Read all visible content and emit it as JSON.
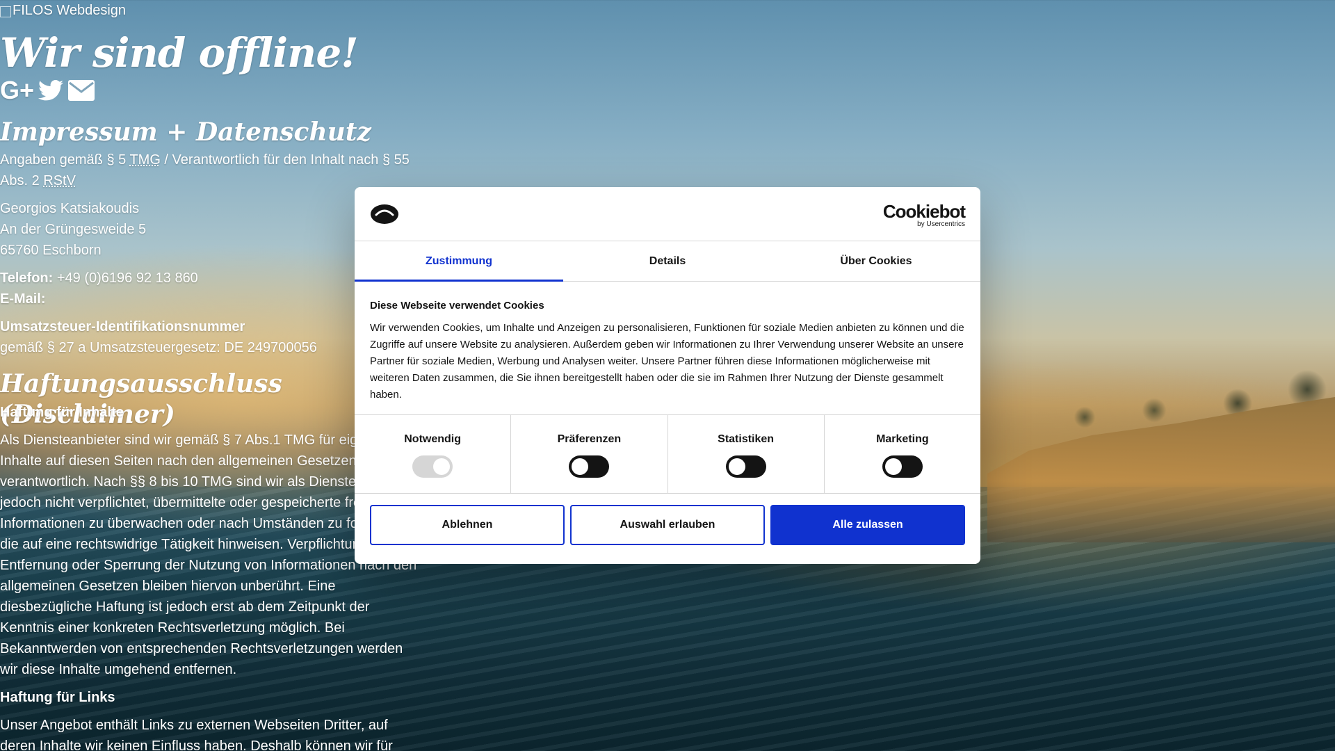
{
  "site": {
    "logo_alt": "FILOS Webdesign",
    "hero_title": "Wir sind offline!",
    "socials": [
      {
        "icon": "google-plus-icon",
        "label": "G+"
      },
      {
        "icon": "twitter-icon"
      },
      {
        "icon": "envelope-icon"
      }
    ],
    "impressum": {
      "title": "Impressum + Datenschutz",
      "intro_prefix": "Angaben gemäß § 5 ",
      "intro_abbr1": "TMG",
      "intro_mid": " / Verantwortlich für den Inhalt nach § 55 Abs. 2 ",
      "intro_abbr2": "RStV",
      "name": "Georgios Katsiakoudis",
      "street": "An der Grüngesweide 5",
      "city": "65760 Eschborn",
      "phone_label": "Telefon:",
      "phone_value": "+49 (0)6196 92 13 860",
      "email_label": "E-Mail:",
      "vat_label": "Umsatzsteuer-Identifikationsnummer",
      "vat_value": "gemäß § 27 a Umsatzsteuergesetz: DE 249700056"
    },
    "disclaimer": {
      "title": "Haftungsausschluss (Disclaimer)",
      "content_heading": "Haftung für Inhalte",
      "content_text": "Als Diensteanbieter sind wir gemäß § 7 Abs.1 TMG für eigene Inhalte auf diesen Seiten nach den allgemeinen Gesetzen verantwortlich. Nach §§ 8 bis 10 TMG sind wir als Diensteanbieter jedoch nicht verpflichtet, übermittelte oder gespeicherte fremde Informationen zu überwachen oder nach Umständen zu forschen, die auf eine rechtswidrige Tätigkeit hinweisen. Verpflichtungen zur Entfernung oder Sperrung der Nutzung von Informationen nach den allgemeinen Gesetzen bleiben hiervon unberührt. Eine diesbezügliche Haftung ist jedoch erst ab dem Zeitpunkt der Kenntnis einer konkreten Rechtsverletzung möglich. Bei Bekanntwerden von entsprechenden Rechtsverletzungen werden wir diese Inhalte umgehend entfernen.",
      "links_heading": "Haftung für Links",
      "links_text": "Unser Angebot enthält Links zu externen Webseiten Dritter, auf deren Inhalte wir keinen Einfluss haben. Deshalb können wir für"
    }
  },
  "cookie_dialog": {
    "brand": "Cookiebot",
    "brand_sub": "by Usercentrics",
    "tabs": [
      "Zustimmung",
      "Details",
      "Über Cookies"
    ],
    "active_tab": "Zustimmung",
    "heading": "Diese Webseite verwendet Cookies",
    "text": "Wir verwenden Cookies, um Inhalte und Anzeigen zu personalisieren, Funktionen für soziale Medien anbieten zu können und die Zugriffe auf unsere Website zu analysieren. Außerdem geben wir Informationen zu Ihrer Verwendung unserer Website an unsere Partner für soziale Medien, Werbung und Analysen weiter. Unsere Partner führen diese Informationen möglicherweise mit weiteren Daten zusammen, die Sie ihnen bereitgestellt haben oder die sie im Rahmen Ihrer Nutzung der Dienste gesammelt haben.",
    "toggles": [
      {
        "label": "Notwendig",
        "state": "on-disabled"
      },
      {
        "label": "Präferenzen",
        "state": "off"
      },
      {
        "label": "Statistiken",
        "state": "off"
      },
      {
        "label": "Marketing",
        "state": "off"
      }
    ],
    "buttons": {
      "decline": "Ablehnen",
      "allow_selection": "Auswahl erlauben",
      "allow_all": "Alle zulassen"
    },
    "accent_color": "#1032cf"
  }
}
